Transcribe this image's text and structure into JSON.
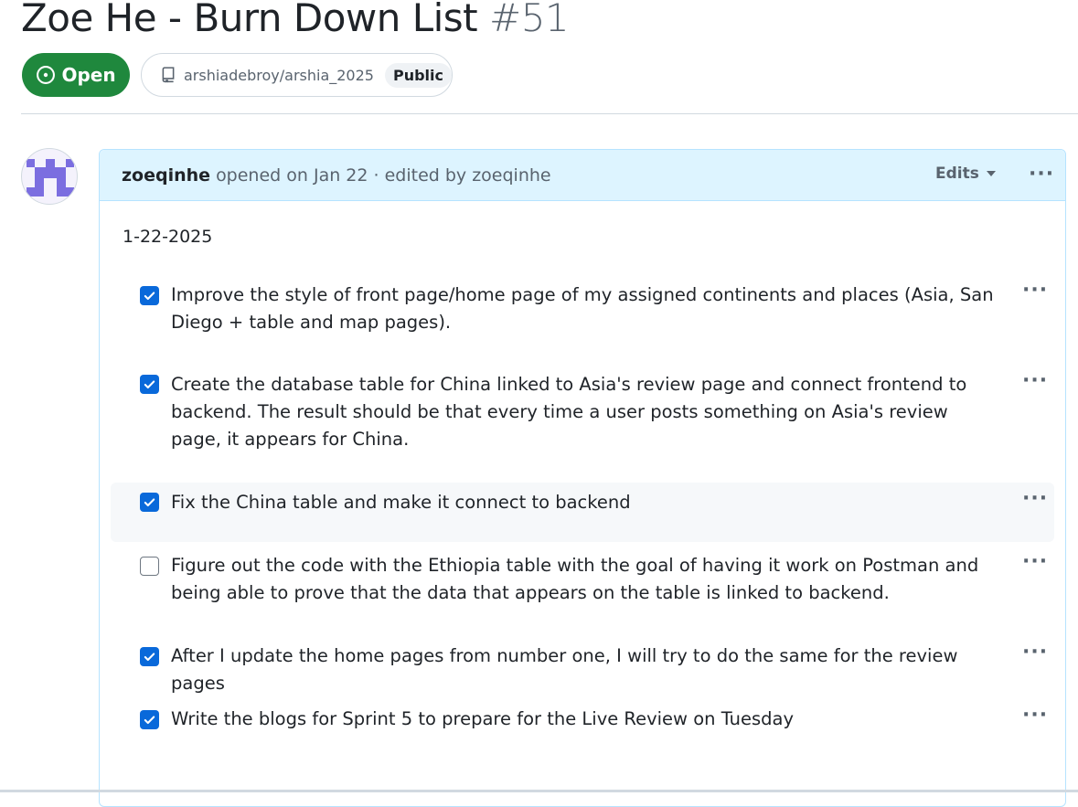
{
  "issue": {
    "title": "Zoe He - Burn Down List",
    "number": "#51",
    "state": "Open",
    "repo": "arshiadebroy/arshia_2025",
    "visibility": "Public"
  },
  "comment": {
    "author": "zoeqinhe",
    "meta": "opened on Jan 22 · edited by zoeqinhe",
    "edits_label": "Edits",
    "date": "1-22-2025",
    "tasks": [
      {
        "checked": true,
        "text": "Improve the style of front page/home page of my assigned continents and places (Asia, San Diego + table and map pages)."
      },
      {
        "checked": true,
        "text": "Create the database table for China linked to Asia's review page and connect frontend to backend. The result should be that every time a user posts something on Asia's review page, it appears for China."
      },
      {
        "checked": true,
        "text": "Fix the China table and make it connect to backend"
      },
      {
        "checked": false,
        "text": "Figure out the code with the Ethiopia table with the goal of having it work on Postman and being able to prove that the data that appears on the table is linked to backend."
      },
      {
        "checked": true,
        "text": "After I update the home pages from number one, I will try to do the same for the review pages"
      },
      {
        "checked": true,
        "text": "Write the blogs for Sprint 5 to prepare for the Live Review on Tuesday"
      }
    ]
  },
  "colors": {
    "open_green": "#1f883d",
    "checkbox_blue": "#0969da",
    "header_bg": "#ddf4ff",
    "avatar_purple": "#7b6ee0"
  },
  "icons": [
    "issue-opened-icon",
    "repo-icon",
    "kebab-horizontal-icon",
    "triangle-down-icon",
    "checkmark-icon",
    "identicon-avatar"
  ]
}
